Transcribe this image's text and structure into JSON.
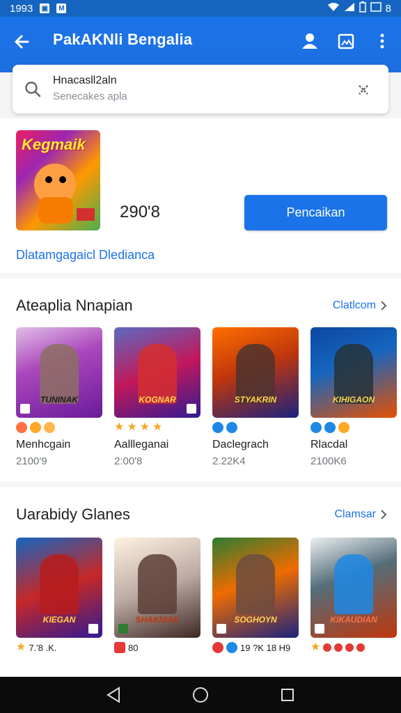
{
  "status_bar": {
    "time": "1993",
    "right_text": "8"
  },
  "app_bar": {
    "title": "PakAKNli Bengalia"
  },
  "search": {
    "value": "Hnacasll2aln",
    "sub": "Senecakes apla"
  },
  "featured": {
    "count": "290'8",
    "button_label": "Pencaikan",
    "link_text": "Dlatamgagaicl Dledianca",
    "cover_title": "Kegmaik"
  },
  "section1": {
    "title": "Ateaplia Nnapian",
    "more": "Clatlcom",
    "cards": [
      {
        "name": "Menhcgain",
        "value": "2100'9",
        "banner": "TUNINAK",
        "rating_icons": [
          "badge-red",
          "badge-orange",
          "badge-orange"
        ]
      },
      {
        "name": "Aallleganai",
        "value": "2:00'8",
        "banner": "KOGNAR",
        "rating_icons": [
          "star",
          "star",
          "star",
          "star"
        ]
      },
      {
        "name": "Daclegrach",
        "value": "2.22K4",
        "banner": "STYAKRIN",
        "rating_icons": [
          "badge-blue",
          "badge-blue"
        ]
      },
      {
        "name": "Rlacdal",
        "value": "2100K6",
        "banner": "KIHIGAON",
        "rating_icons": [
          "badge-blue",
          "badge-blue",
          "badge-orange"
        ]
      }
    ]
  },
  "section2": {
    "title": "Uarabidy Glanes",
    "more": "Clamsar",
    "cards": [
      {
        "badge_text": "7.'8 .K.",
        "banner": "KIEGAN"
      },
      {
        "badge_text": "80",
        "banner": "SHAKNIAK"
      },
      {
        "badge_text": "19 ?K 18 H9",
        "banner": "SOGHOYN"
      },
      {
        "badge_text": "",
        "banner": "KIKAUDIAN"
      }
    ]
  },
  "colors": {
    "primary": "#1a73e8",
    "status_bar": "#1565c0",
    "nav_bar": "#0b0b0b"
  }
}
